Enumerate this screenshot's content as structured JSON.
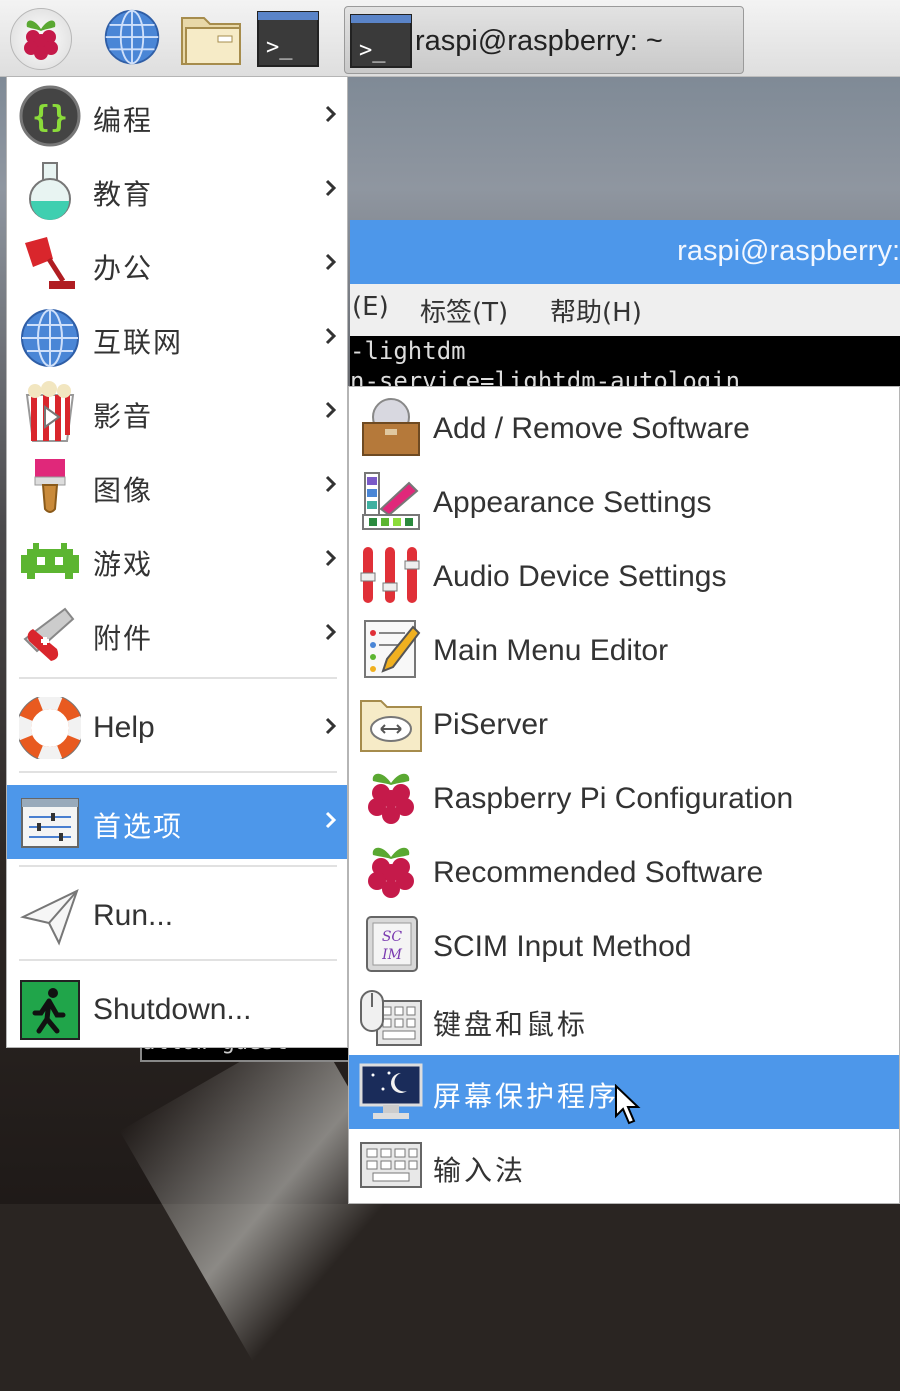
{
  "colors": {
    "accent": "#4d97ea",
    "menu_bg": "#ffffff",
    "text": "#333333"
  },
  "taskbar": {
    "menu_button_icon": "raspberry-icon",
    "launchers": [
      {
        "name": "web-browser",
        "icon": "globe-icon"
      },
      {
        "name": "file-manager",
        "icon": "folder-icon"
      },
      {
        "name": "terminal",
        "icon": "terminal-icon"
      }
    ],
    "active_task": {
      "label": "raspi@raspberry: ~",
      "icon": "terminal-icon"
    }
  },
  "terminal": {
    "title": "raspi@raspberry:",
    "menu": [
      "(E)",
      "标签(T)",
      "帮助(H)"
    ],
    "lines": [
      "-lightdm",
      "n-service=lightdm-autologin"
    ],
    "bottom_fragment": "allow-guest"
  },
  "main_menu": {
    "items": [
      {
        "label": "编程",
        "icon": "programming-icon",
        "submenu": true
      },
      {
        "label": "教育",
        "icon": "education-flask-icon",
        "submenu": true
      },
      {
        "label": "办公",
        "icon": "office-lamp-icon",
        "submenu": true
      },
      {
        "label": "互联网",
        "icon": "globe-icon",
        "submenu": true
      },
      {
        "label": "影音",
        "icon": "popcorn-icon",
        "submenu": true
      },
      {
        "label": "图像",
        "icon": "paintbrush-icon",
        "submenu": true
      },
      {
        "label": "游戏",
        "icon": "space-invader-icon",
        "submenu": true
      },
      {
        "label": "附件",
        "icon": "swiss-knife-icon",
        "submenu": true
      },
      {
        "label": "Help",
        "icon": "lifebuoy-icon",
        "submenu": true
      },
      {
        "label": "首选项",
        "icon": "preferences-sliders-icon",
        "submenu": true,
        "selected": true
      },
      {
        "label": "Run...",
        "icon": "paper-plane-icon",
        "submenu": false
      },
      {
        "label": "Shutdown...",
        "icon": "exit-icon",
        "submenu": false
      }
    ]
  },
  "sub_menu": {
    "items": [
      {
        "label": "Add / Remove Software",
        "icon": "software-box-icon"
      },
      {
        "label": "Appearance Settings",
        "icon": "color-swatch-icon"
      },
      {
        "label": "Audio Device Settings",
        "icon": "audio-mixer-icon"
      },
      {
        "label": "Main Menu Editor",
        "icon": "menu-editor-icon"
      },
      {
        "label": "PiServer",
        "icon": "network-folder-icon"
      },
      {
        "label": "Raspberry Pi Configuration",
        "icon": "raspberry-icon"
      },
      {
        "label": "Recommended Software",
        "icon": "raspberry-icon"
      },
      {
        "label": "SCIM Input Method",
        "icon": "scim-icon"
      },
      {
        "label": "键盘和鼠标",
        "icon": "keyboard-mouse-icon"
      },
      {
        "label": "屏幕保护程序",
        "icon": "screensaver-monitor-icon",
        "selected": true
      },
      {
        "label": "输入法",
        "icon": "keyboard-icon"
      }
    ]
  }
}
